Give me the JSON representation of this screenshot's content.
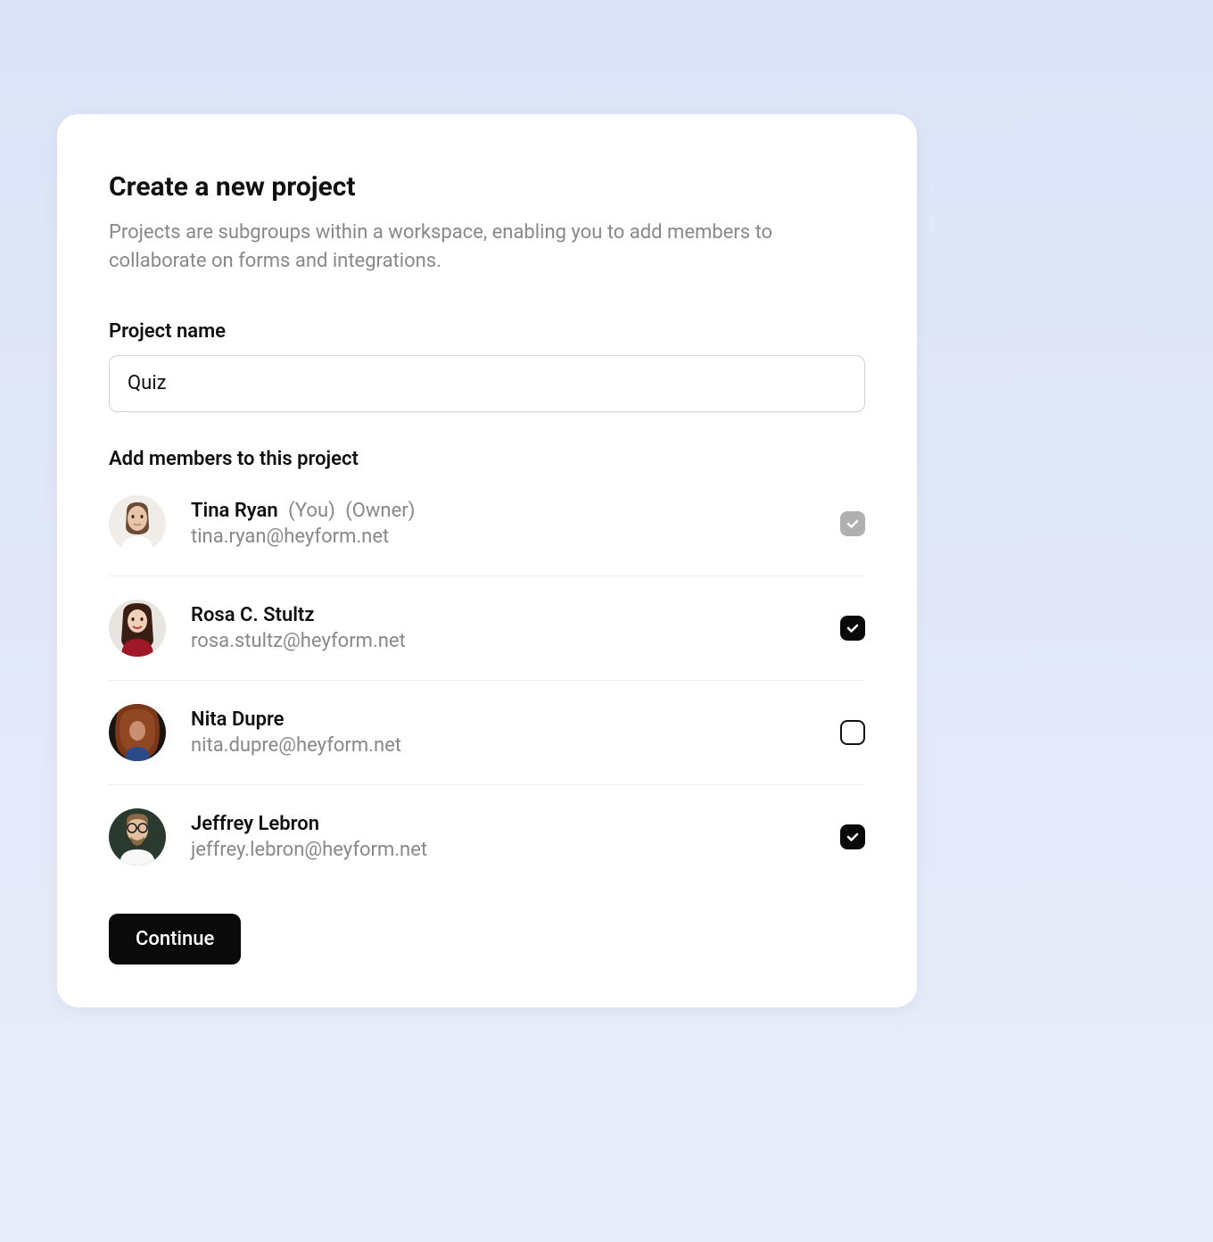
{
  "header": {
    "title": "Create a new project",
    "subtitle": "Projects are subgroups within a workspace, enabling you to add members to collaborate on forms and integrations."
  },
  "form": {
    "project_name_label": "Project name",
    "project_name_value": "Quiz",
    "members_label": "Add members to this project"
  },
  "members": [
    {
      "name": "Tina Ryan",
      "you_badge": "(You)",
      "owner_badge": "(Owner)",
      "email": "tina.ryan@heyform.net",
      "checked": true,
      "disabled": true
    },
    {
      "name": "Rosa C. Stultz",
      "email": "rosa.stultz@heyform.net",
      "checked": true,
      "disabled": false
    },
    {
      "name": "Nita Dupre",
      "email": "nita.dupre@heyform.net",
      "checked": false,
      "disabled": false
    },
    {
      "name": "Jeffrey Lebron",
      "email": "jeffrey.lebron@heyform.net",
      "checked": true,
      "disabled": false
    }
  ],
  "actions": {
    "continue_label": "Continue"
  }
}
